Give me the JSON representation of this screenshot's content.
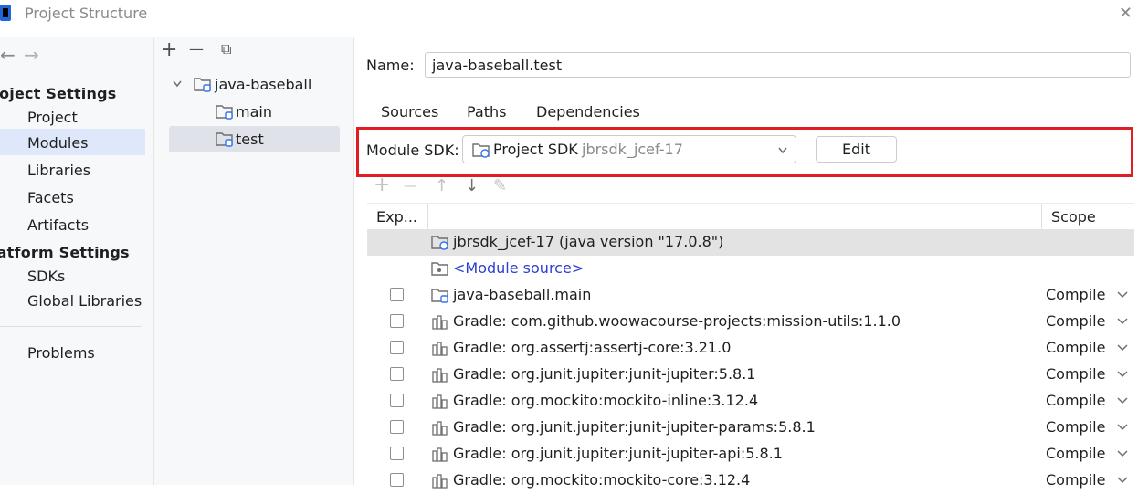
{
  "window": {
    "title": "Project Structure"
  },
  "sidebar": {
    "nav_back": "←",
    "nav_forward": "→",
    "project_settings_header": "roject Settings",
    "project_items": [
      "Project",
      "Modules",
      "Libraries",
      "Facets",
      "Artifacts"
    ],
    "platform_settings_header": "latform Settings",
    "platform_items": [
      "SDKs",
      "Global Libraries"
    ],
    "problems": "Problems",
    "selected": "Modules"
  },
  "tree": {
    "toolbar": {
      "add": "+",
      "remove": "—",
      "copy": "⧉"
    },
    "root": "java-baseball",
    "children": [
      "main",
      "test"
    ],
    "selected": "test"
  },
  "module": {
    "name_label": "Name:",
    "name_value": "java-baseball.test",
    "tabs": [
      "Sources",
      "Paths",
      "Dependencies"
    ],
    "active_tab": "Dependencies",
    "sdk_label": "Module SDK:",
    "sdk_value": "Project SDK",
    "sdk_value_hint": "jbrsdk_jcef-17",
    "edit_button": "Edit"
  },
  "deps_toolbar": {
    "add": "+",
    "remove": "—",
    "up": "↑",
    "down": "↓",
    "edit": "✎"
  },
  "deps_table": {
    "headers": {
      "export": "Exp...",
      "scope": "Scope"
    },
    "rows": [
      {
        "name": "jbrsdk_jcef-17 (java version \"17.0.8\")",
        "scope": "",
        "checkbox": false,
        "icon": "sdk-folder-icon",
        "link": false,
        "selected": true
      },
      {
        "name": "<Module source>",
        "scope": "",
        "checkbox": false,
        "icon": "module-source-icon",
        "link": true,
        "selected": false
      },
      {
        "name": "java-baseball.main",
        "scope": "Compile",
        "checkbox": true,
        "icon": "module-folder-icon",
        "link": false,
        "selected": false
      },
      {
        "name": "Gradle: com.github.woowacourse-projects:mission-utils:1.1.0",
        "scope": "Compile",
        "checkbox": true,
        "icon": "library-icon",
        "link": false,
        "selected": false
      },
      {
        "name": "Gradle: org.assertj:assertj-core:3.21.0",
        "scope": "Compile",
        "checkbox": true,
        "icon": "library-icon",
        "link": false,
        "selected": false
      },
      {
        "name": "Gradle: org.junit.jupiter:junit-jupiter:5.8.1",
        "scope": "Compile",
        "checkbox": true,
        "icon": "library-icon",
        "link": false,
        "selected": false
      },
      {
        "name": "Gradle: org.mockito:mockito-inline:3.12.4",
        "scope": "Compile",
        "checkbox": true,
        "icon": "library-icon",
        "link": false,
        "selected": false
      },
      {
        "name": "Gradle: org.junit.jupiter:junit-jupiter-params:5.8.1",
        "scope": "Compile",
        "checkbox": true,
        "icon": "library-icon",
        "link": false,
        "selected": false
      },
      {
        "name": "Gradle: org.junit.jupiter:junit-jupiter-api:5.8.1",
        "scope": "Compile",
        "checkbox": true,
        "icon": "library-icon",
        "link": false,
        "selected": false
      },
      {
        "name": "Gradle: org.mockito:mockito-core:3.12.4",
        "scope": "Compile",
        "checkbox": true,
        "icon": "library-icon",
        "link": false,
        "selected": false
      }
    ]
  },
  "colors": {
    "selection": "#dfe8fb",
    "highlight_border": "#e11d24",
    "link": "#2b3fd1"
  }
}
